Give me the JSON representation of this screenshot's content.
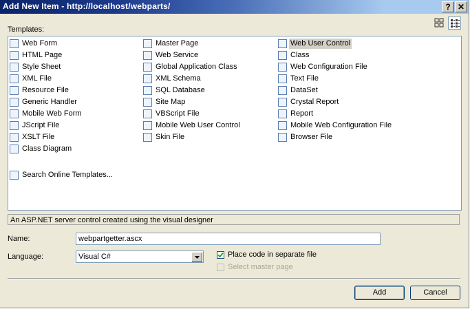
{
  "window": {
    "title": "Add New Item - http://localhost/webparts/",
    "help_button": "?",
    "close_button": "✕"
  },
  "templates_label": "Templates:",
  "templates": {
    "columns": [
      [
        {
          "label": "Web Form",
          "icon": "web-form-icon"
        },
        {
          "label": "HTML Page",
          "icon": "html-page-icon"
        },
        {
          "label": "Style Sheet",
          "icon": "style-sheet-icon"
        },
        {
          "label": "XML File",
          "icon": "xml-file-icon"
        },
        {
          "label": "Resource File",
          "icon": "resource-file-icon"
        },
        {
          "label": "Generic Handler",
          "icon": "generic-handler-icon"
        },
        {
          "label": "Mobile Web Form",
          "icon": "mobile-web-form-icon"
        },
        {
          "label": "JScript File",
          "icon": "jscript-file-icon"
        },
        {
          "label": "XSLT File",
          "icon": "xslt-file-icon"
        },
        {
          "label": "Class Diagram",
          "icon": "class-diagram-icon"
        }
      ],
      [
        {
          "label": "Master Page",
          "icon": "master-page-icon"
        },
        {
          "label": "Web Service",
          "icon": "web-service-icon"
        },
        {
          "label": "Global Application Class",
          "icon": "global-application-class-icon"
        },
        {
          "label": "XML Schema",
          "icon": "xml-schema-icon"
        },
        {
          "label": "SQL Database",
          "icon": "sql-database-icon"
        },
        {
          "label": "Site Map",
          "icon": "site-map-icon"
        },
        {
          "label": "VBScript File",
          "icon": "vbscript-file-icon"
        },
        {
          "label": "Mobile Web User Control",
          "icon": "mobile-web-user-control-icon"
        },
        {
          "label": "Skin File",
          "icon": "skin-file-icon"
        }
      ],
      [
        {
          "label": "Web User Control",
          "icon": "web-user-control-icon",
          "selected": true
        },
        {
          "label": "Class",
          "icon": "class-icon"
        },
        {
          "label": "Web Configuration File",
          "icon": "web-configuration-file-icon"
        },
        {
          "label": "Text File",
          "icon": "text-file-icon"
        },
        {
          "label": "DataSet",
          "icon": "dataset-icon"
        },
        {
          "label": "Crystal Report",
          "icon": "crystal-report-icon"
        },
        {
          "label": "Report",
          "icon": "report-icon"
        },
        {
          "label": "Mobile Web Configuration File",
          "icon": "mobile-web-configuration-file-icon"
        },
        {
          "label": "Browser File",
          "icon": "browser-file-icon"
        }
      ]
    ],
    "online": {
      "label": "Search Online Templates...",
      "icon": "search-online-templates-icon"
    }
  },
  "description": "An ASP.NET server control created using the visual designer",
  "name_label": "Name:",
  "name_value": "webpartgetter.ascx",
  "language_label": "Language:",
  "language_value": "Visual C#",
  "place_code_label": "Place code in separate file",
  "place_code_checked": true,
  "select_master_label": "Select master page",
  "select_master_checked": false,
  "add_button": "Add",
  "cancel_button": "Cancel",
  "colors": {
    "title_start": "#0a246a",
    "title_end": "#a6caf0",
    "dialog_bg": "#ece9d8",
    "border": "#7f9db9"
  }
}
